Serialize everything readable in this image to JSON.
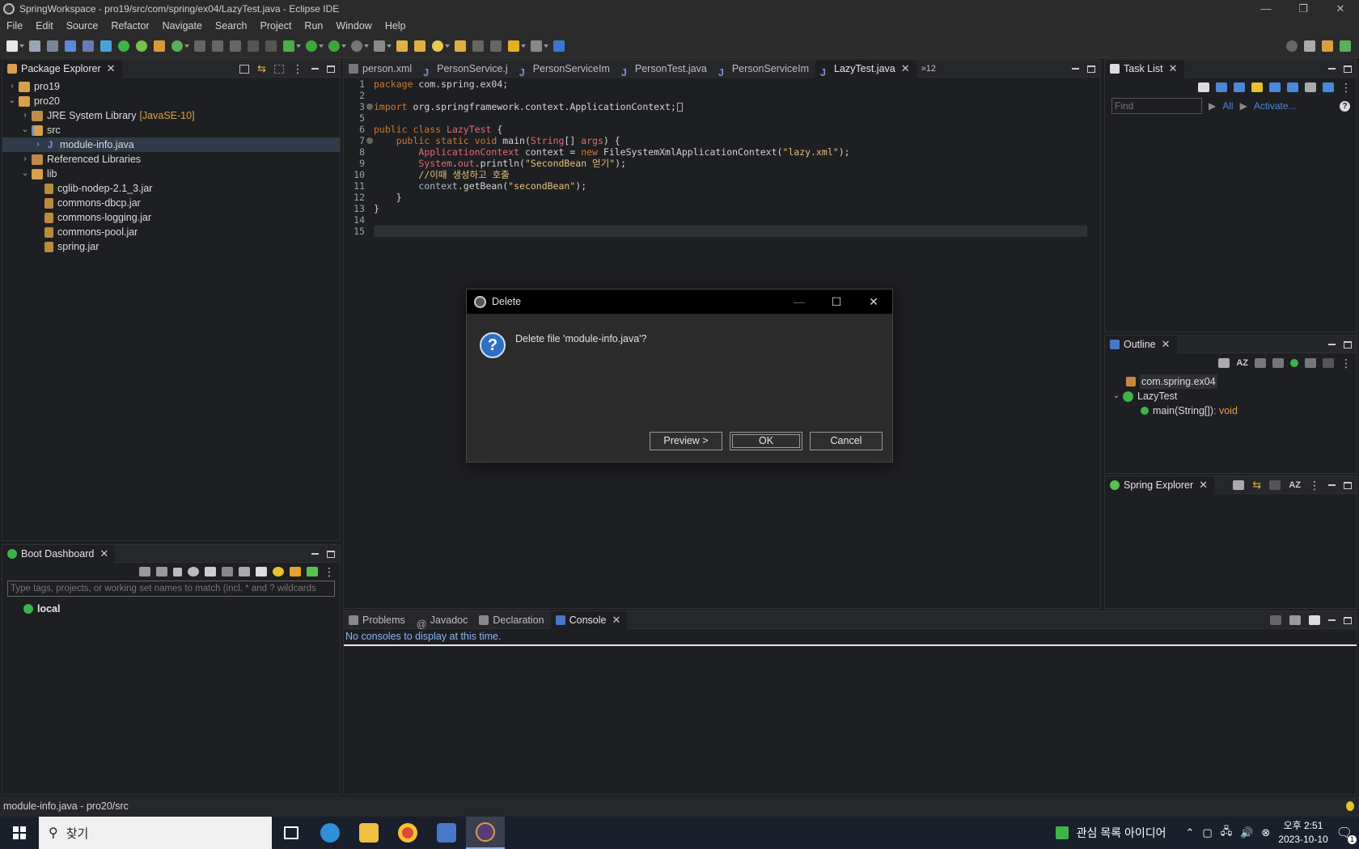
{
  "window": {
    "title": "SpringWorkspace - pro19/src/com/spring/ex04/LazyTest.java - Eclipse IDE",
    "controls": {
      "minimize": "—",
      "maximize": "❐",
      "close": "✕"
    }
  },
  "menu": [
    "File",
    "Edit",
    "Source",
    "Refactor",
    "Navigate",
    "Search",
    "Project",
    "Run",
    "Window",
    "Help"
  ],
  "package_explorer": {
    "title": "Package Explorer",
    "tree": [
      {
        "label": "pro19",
        "level": 0,
        "chevron": "›",
        "icon": "project-folder-icon"
      },
      {
        "label": "pro20",
        "level": 0,
        "chevron": "⌄",
        "icon": "project-folder-icon"
      },
      {
        "label": "JRE System Library",
        "decoration": "[JavaSE-10]",
        "level": 1,
        "chevron": "›",
        "icon": "library-icon"
      },
      {
        "label": "src",
        "level": 1,
        "chevron": "⌄",
        "icon": "source-folder-icon"
      },
      {
        "label": "module-info.java",
        "level": 2,
        "chevron": "›",
        "icon": "java-file-icon",
        "selected": true
      },
      {
        "label": "Referenced Libraries",
        "level": 1,
        "chevron": "›",
        "icon": "library-icon"
      },
      {
        "label": "lib",
        "level": 1,
        "chevron": "⌄",
        "icon": "folder-icon"
      },
      {
        "label": "cglib-nodep-2.1_3.jar",
        "level": 2,
        "chevron": "",
        "icon": "jar-icon"
      },
      {
        "label": "commons-dbcp.jar",
        "level": 2,
        "chevron": "",
        "icon": "jar-icon"
      },
      {
        "label": "commons-logging.jar",
        "level": 2,
        "chevron": "",
        "icon": "jar-icon"
      },
      {
        "label": "commons-pool.jar",
        "level": 2,
        "chevron": "",
        "icon": "jar-icon"
      },
      {
        "label": "spring.jar",
        "level": 2,
        "chevron": "",
        "icon": "jar-icon"
      }
    ]
  },
  "boot_dashboard": {
    "title": "Boot Dashboard",
    "filter_placeholder": "Type tags, projects, or working set names to match (incl. * and ? wildcards",
    "items": [
      "local"
    ]
  },
  "editor": {
    "tabs": [
      {
        "label": "person.xml",
        "active": false
      },
      {
        "label": "PersonService.j",
        "active": false
      },
      {
        "label": "PersonServiceIm",
        "active": false
      },
      {
        "label": "PersonTest.java",
        "active": false
      },
      {
        "label": "PersonServiceIm",
        "active": false
      },
      {
        "label": "LazyTest.java",
        "active": true
      }
    ],
    "overflow": "»12",
    "line_numbers": [
      "1",
      "2",
      "3",
      "5",
      "6",
      "7",
      "8",
      "9",
      "10",
      "11",
      "12",
      "13",
      "14",
      "15"
    ],
    "lines": {
      "l1_kw": "package",
      "l1_rest": " com.spring.ex04;",
      "l3_kw": "import",
      "l3_rest": " org.springframework.context.ApplicationContext;",
      "l6_kw": "public class",
      "l6_cls": "LazyTest",
      "l6_rest": " {",
      "l7_kw": "public static void",
      "l7_name": " main(",
      "l7_type": "String",
      "l7_rest": "[] ",
      "l7_var": "args",
      "l7_end": ") {",
      "l8_type": "ApplicationContext",
      "l8_var": " context",
      "l8_eq": " = ",
      "l8_kw": "new",
      "l8_ctor": " FileSystemXmlApplicationContext(",
      "l8_str": "\"lazy.xml\"",
      "l8_end": ");",
      "l9_cls": "System",
      "l9_dot": ".",
      "l9_fld": "out",
      "l9_call": ".println(",
      "l9_str": "\"SecondBean 얻기\"",
      "l9_end": ");",
      "l10_cmt": "//이때 생성하고 호출",
      "l11_var": "context",
      "l11_call": ".getBean(",
      "l11_str": "\"secondBean\"",
      "l11_end": ");",
      "l12": "}",
      "l13": "}"
    }
  },
  "dialog": {
    "title": "Delete",
    "message": "Delete file 'module-info.java'?",
    "buttons": {
      "preview": "Preview >",
      "ok": "OK",
      "cancel": "Cancel"
    }
  },
  "bottom_panel": {
    "tabs": [
      {
        "label": "Problems",
        "active": false
      },
      {
        "label": "Javadoc",
        "active": false
      },
      {
        "label": "Declaration",
        "active": false
      },
      {
        "label": "Console",
        "active": true
      }
    ],
    "console_message": "No consoles to display at this time."
  },
  "task_list": {
    "title": "Task List",
    "find_placeholder": "Find",
    "all_link": "All",
    "activate_link": "Activate..."
  },
  "outline": {
    "title": "Outline",
    "items": [
      {
        "label": "com.spring.ex04",
        "suffix": ""
      },
      {
        "label": "LazyTest",
        "suffix": ""
      },
      {
        "label": "main(String[])",
        "suffix": " : void"
      }
    ]
  },
  "spring_explorer": {
    "title": "Spring Explorer"
  },
  "status_bar": {
    "text": "module-info.java - pro20/src"
  },
  "taskbar": {
    "search_placeholder": "찾기",
    "tray_widget": "관심 목록 아이디어",
    "time": "오후 2:51",
    "date": "2023-10-10",
    "notifications": "1"
  },
  "colors": {
    "accent": "#4a88d8",
    "keyword": "#cc7832",
    "string": "#e6c07b",
    "selection": "#2f3a4a"
  }
}
